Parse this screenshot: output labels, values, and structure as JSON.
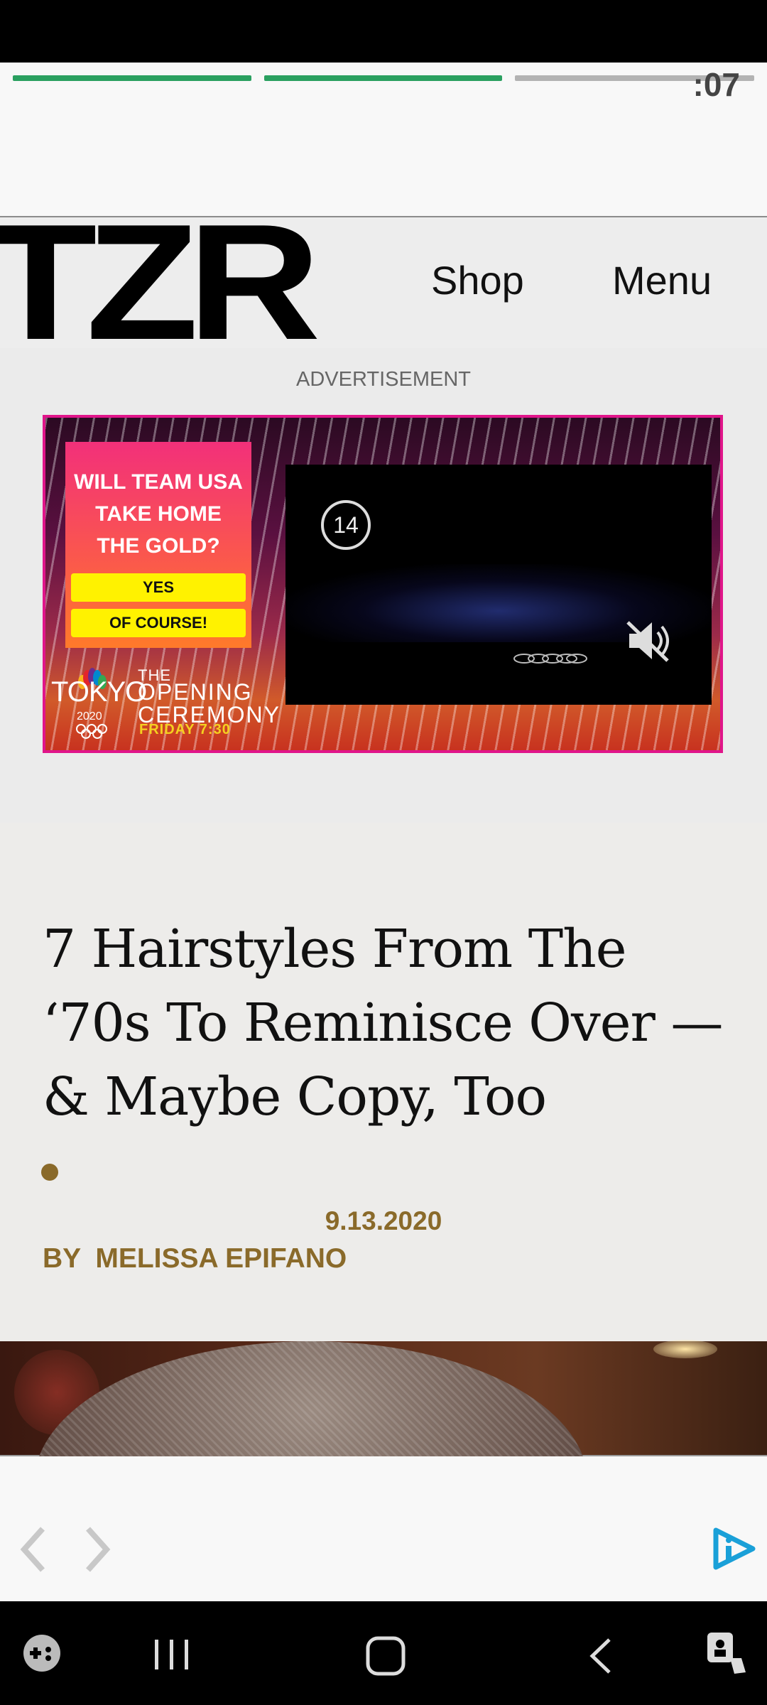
{
  "story": {
    "progress": [
      {
        "state": "complete",
        "color": "#2aa060"
      },
      {
        "state": "complete",
        "color": "#2aa060"
      },
      {
        "state": "pending",
        "color": "#b3b3b3"
      }
    ],
    "timer": ":07"
  },
  "header": {
    "logo": "TZR",
    "nav": {
      "shop": "Shop",
      "menu": "Menu"
    }
  },
  "ad": {
    "label": "ADVERTISEMENT",
    "question_lines": [
      "WILL TEAM USA",
      "TAKE HOME",
      "THE GOLD?"
    ],
    "options": [
      "YES",
      "OF COURSE!"
    ],
    "brand": "TOKYO",
    "brand_year": "2020",
    "event_small": "THE",
    "event_lines": [
      "OPENING",
      "CEREMONY"
    ],
    "event_time": "FRIDAY 7:30",
    "video_countdown": "14",
    "accent_color": "#e0158a"
  },
  "article": {
    "headline": "7 Hairstyles From The ‘70s To Reminisce Over — & Maybe Copy, Too",
    "date": "9.13.2020",
    "byline_prefix": "BY",
    "author": "MELISSA EPIFANO",
    "meta_color": "#8a6a2a"
  },
  "bottom_bar": {
    "icons": [
      "chevron-left-icon",
      "chevron-right-icon",
      "adchoices-icon"
    ]
  },
  "system_nav": {
    "icons": [
      "game-launcher-icon",
      "recents-icon",
      "home-icon",
      "back-icon",
      "accessibility-icon"
    ]
  }
}
